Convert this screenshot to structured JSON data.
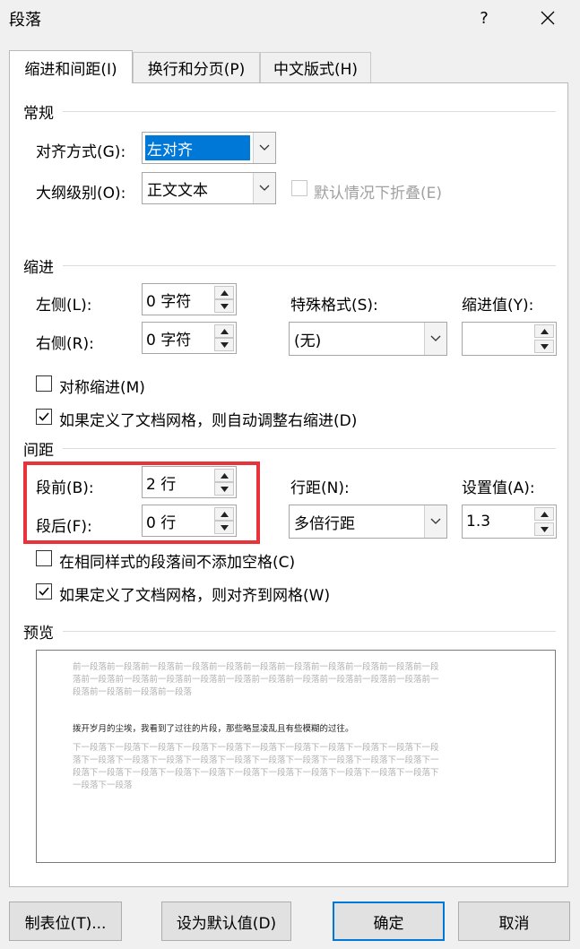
{
  "window": {
    "title": "段落",
    "help_label": "?",
    "close_label": "✕"
  },
  "tabs": [
    {
      "label": "缩进和间距(I)"
    },
    {
      "label": "换行和分页(P)"
    },
    {
      "label": "中文版式(H)"
    }
  ],
  "general": {
    "heading": "常规",
    "alignment_label": "对齐方式(G):",
    "alignment_value": "左对齐",
    "outline_label": "大纲级别(O):",
    "outline_value": "正文文本",
    "collapse_label": "默认情况下折叠(E)"
  },
  "indent": {
    "heading": "缩进",
    "left_label": "左侧(L):",
    "left_value": "0 字符",
    "right_label": "右侧(R):",
    "right_value": "0 字符",
    "special_label": "特殊格式(S):",
    "special_value": "(无)",
    "by_label": "缩进值(Y):",
    "by_value": "",
    "mirror_label": "对称缩进(M)",
    "auto_adjust_label": "如果定义了文档网格，则自动调整右缩进(D)"
  },
  "spacing": {
    "heading": "间距",
    "before_label": "段前(B):",
    "before_value": "2 行",
    "after_label": "段后(F):",
    "after_value": "0 行",
    "line_label": "行距(N):",
    "line_value": "多倍行距",
    "at_label": "设置值(A):",
    "at_value": "1.3",
    "no_space_label": "在相同样式的段落间不添加空格(C)",
    "snap_grid_label": "如果定义了文档网格，则对齐到网格(W)"
  },
  "preview": {
    "heading": "预览",
    "prev_lines": [
      "前一段落前一段落前一段落前一段落前一段落前一段落前一段落前一段落前一段落前一段落前一段",
      "落前一段落前一段落前一段落前一段落前一段落前一段落前一段落前一段落前一段落前一段落前一",
      "段落前一段落前一段落前一段落"
    ],
    "sample_text": "拨开岁月的尘埃，我看到了过往的片段，那些略显凌乱且有些模糊的过往。",
    "next_lines": [
      "下一段落下一段落下一段落下一段落下一段落下一段落下一段落下一段落下一段落下一段落下一段",
      "落下一段落下一段落下一段落下一段落下一段落下一段落下一段落下一段落下一段落下一段落下一",
      "段落下一段落下一段落下一段落下一段落下一段落下一段落下一段落下一段落下一段落下一段落下",
      "一段落下一段落"
    ]
  },
  "buttons": {
    "tabs_label": "制表位(T)...",
    "default_label": "设为默认值(D)",
    "ok_label": "确定",
    "cancel_label": "取消"
  },
  "colors": {
    "highlight_box": "#e8333a",
    "selection": "#0078d7"
  }
}
